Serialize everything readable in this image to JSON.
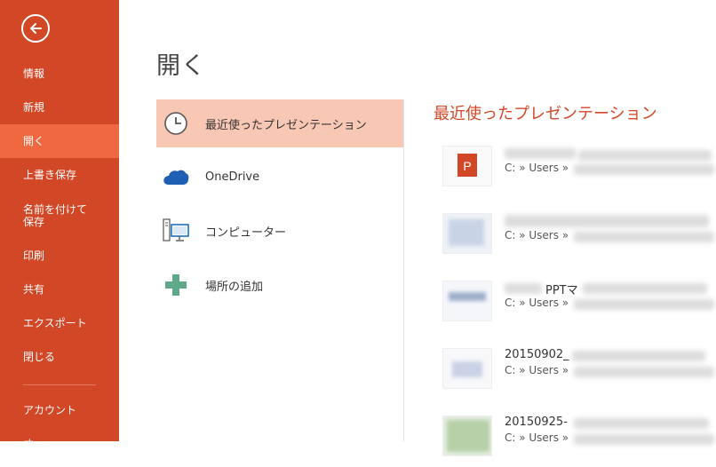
{
  "sidebar": {
    "back_icon": "arrow-left-circle-icon",
    "items": [
      {
        "label": "情報"
      },
      {
        "label": "新規"
      },
      {
        "label": "開く"
      },
      {
        "label": "上書き保存"
      },
      {
        "label": "名前を付けて\n保存"
      },
      {
        "label": "印刷"
      },
      {
        "label": "共有"
      },
      {
        "label": "エクスポート"
      },
      {
        "label": "閉じる"
      },
      {
        "label": "アカウント"
      }
    ],
    "bg_color": "#d24726",
    "active_color": "#f0683f"
  },
  "main": {
    "title": "開く",
    "places": [
      {
        "label": "最近使ったプレゼンテーション",
        "icon": "clock-icon"
      },
      {
        "label": "OneDrive",
        "icon": "cloud-icon"
      },
      {
        "label": "コンピューター",
        "icon": "computer-icon"
      },
      {
        "label": "場所の追加",
        "icon": "plus-icon"
      }
    ],
    "recent_title": "最近使ったプレゼンテーション",
    "files": [
      {
        "name": "",
        "path": "C: » Users »"
      },
      {
        "name": "",
        "path": "C: » Users »"
      },
      {
        "name": "PPTマ",
        "path": "C: » Users »"
      },
      {
        "name": "20150902_",
        "path": "C: » Users »"
      },
      {
        "name": "20150925-",
        "path": "C: » Users »"
      }
    ],
    "accent_color": "#d24726"
  }
}
